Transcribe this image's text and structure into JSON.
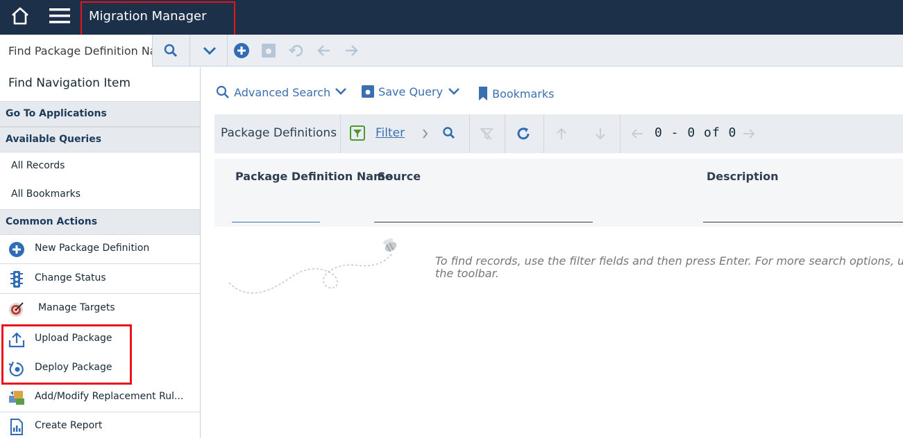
{
  "header": {
    "app_title": "Migration Manager",
    "home_icon": "home-icon",
    "menu_icon": "hamburger-menu-icon",
    "bg_color": "#1c3049",
    "highlight_color": "#e8141a"
  },
  "toolbar": {
    "find_placeholder": "Find Package Definition Name",
    "icons": [
      "search-icon",
      "chevron-down-icon",
      "add-circle-icon",
      "save-icon",
      "undo-icon",
      "arrow-left-icon",
      "arrow-right-icon"
    ]
  },
  "sidebar": {
    "find_nav_label": "Find Navigation Item",
    "go_to_applications": "Go To Applications",
    "available_queries": "Available Queries",
    "queries": [
      "All Records",
      "All Bookmarks"
    ],
    "common_actions": "Common Actions",
    "actions": [
      {
        "label": "New Package Definition",
        "icon": "add-circle-icon"
      },
      {
        "label": "Change Status",
        "icon": "traffic-light-icon"
      },
      {
        "label": "Manage Targets",
        "icon": "target-icon"
      },
      {
        "label": "Upload Package",
        "icon": "upload-icon"
      },
      {
        "label": "Deploy Package",
        "icon": "deploy-icon"
      },
      {
        "label": "Add/Modify Replacement Rul...",
        "icon": "replacement-rules-icon"
      },
      {
        "label": "Create Report",
        "icon": "report-icon"
      }
    ]
  },
  "main": {
    "advanced_search": "Advanced Search",
    "save_query": "Save Query",
    "bookmarks": "Bookmarks",
    "grid": {
      "title": "Package Definitions",
      "filter_label": "Filter",
      "count_text": "0 - 0 of 0",
      "columns": [
        "Package Definition Name",
        "Source",
        "Description"
      ]
    },
    "empty_message_line1": "To find records, use the filter fields and then press Enter. For more search options, use the",
    "empty_message_line2": "the toolbar."
  }
}
